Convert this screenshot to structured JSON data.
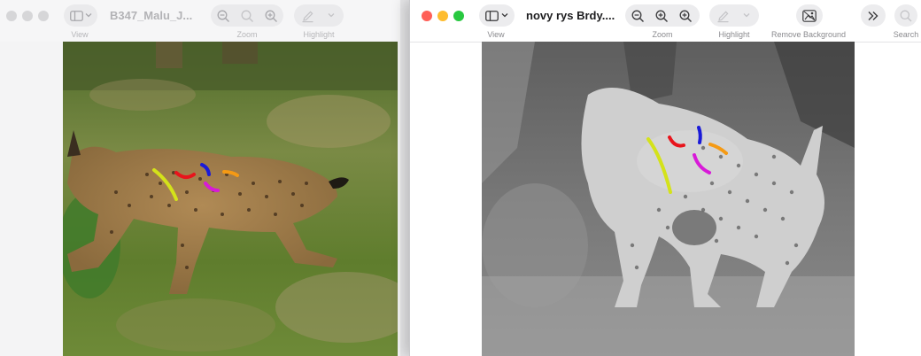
{
  "left_window": {
    "title": "B347_Malu_J...",
    "toolbar": {
      "view_label": "View",
      "zoom_label": "Zoom",
      "highlight_label": "Highlight"
    },
    "icons": [
      "sidebar-icon",
      "chevron-down-icon",
      "zoom-out-icon",
      "zoom-fit-icon",
      "zoom-in-icon",
      "pencil-icon",
      "chevron-down-icon"
    ]
  },
  "right_window": {
    "title": "novy rys Brdy....",
    "toolbar": {
      "view_label": "View",
      "zoom_label": "Zoom",
      "highlight_label": "Highlight",
      "remove_background_label": "Remove Background",
      "search_label": "Search"
    },
    "icons": [
      "sidebar-icon",
      "chevron-down-icon",
      "zoom-out-icon",
      "zoom-in-icon",
      "zoom-in-plus-icon",
      "pencil-icon",
      "chevron-down-icon",
      "remove-background-icon",
      "more-chevrons-icon",
      "search-icon"
    ]
  },
  "colors": {
    "close": "#ff5f57",
    "minimize": "#febc2e",
    "maximize": "#28c840",
    "marker_yellow": "#d4e21a",
    "marker_red": "#e8141c",
    "marker_blue": "#1a1ad8",
    "marker_magenta": "#d81ad8",
    "marker_orange": "#f59a14"
  }
}
